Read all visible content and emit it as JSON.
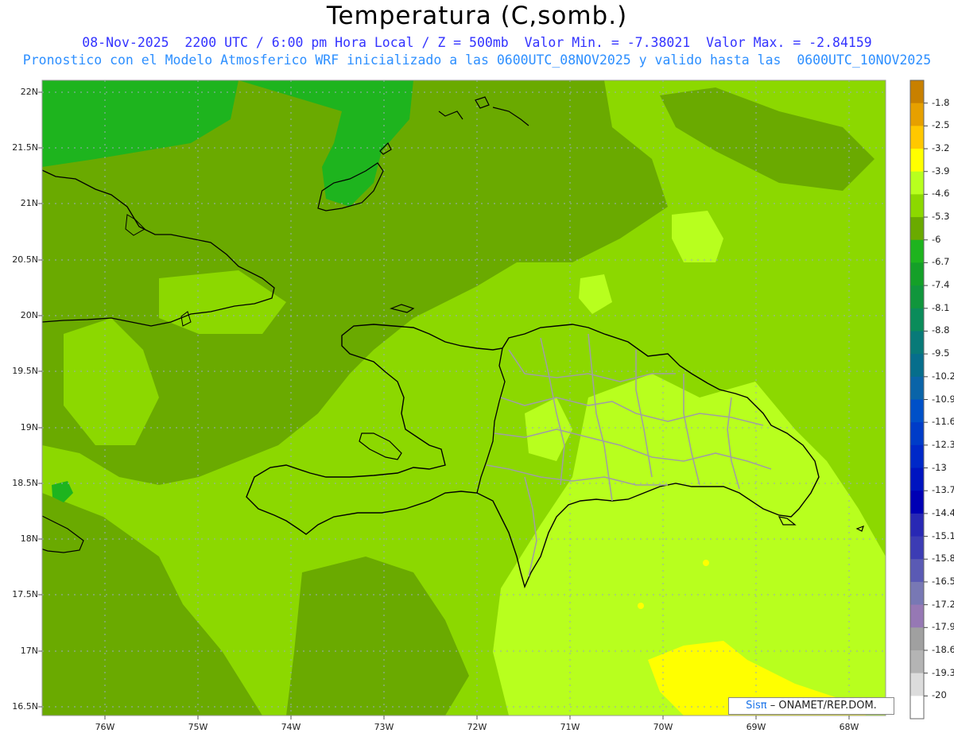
{
  "header": {
    "title": "Temperatura (C,somb.)",
    "subtitle_1": "08-Nov-2025  2200 UTC / 6:00 pm Hora Local / Z = 500mb  Valor Min. = -7.38021  Valor Max. = -2.84159",
    "subtitle_2": "Pronostico con el Modelo Atmosferico WRF inicializado a las 0600UTC_08NOV2025 y valido hasta las  0600UTC_10NOV2025"
  },
  "axes": {
    "lat_labels": [
      "22N",
      "21.5N",
      "21N",
      "20.5N",
      "20N",
      "19.5N",
      "19N",
      "18.5N",
      "18N",
      "17.5N",
      "17N",
      "16.5N"
    ],
    "lon_labels": [
      "76W",
      "75W",
      "74W",
      "73W",
      "72W",
      "71W",
      "70W",
      "69W",
      "68W"
    ]
  },
  "colorbar": {
    "labels": [
      "-1.8",
      "-2.5",
      "-3.2",
      "-3.9",
      "-4.6",
      "-5.3",
      "-6",
      "-6.7",
      "-7.4",
      "-8.1",
      "-8.8",
      "-9.5",
      "-10.2",
      "-10.9",
      "-11.6",
      "-12.3",
      "-13",
      "-13.7",
      "-14.4",
      "-15.1",
      "-15.8",
      "-16.5",
      "-17.2",
      "-17.9",
      "-18.6",
      "-19.3",
      "-20"
    ],
    "colors": [
      "#c88000",
      "#e6a000",
      "#ffc800",
      "#ffff00",
      "#b8ff1e",
      "#8cd800",
      "#6aaa00",
      "#1eb41e",
      "#14a028",
      "#10963c",
      "#0a8c5a",
      "#087a78",
      "#066e8c",
      "#0a64a8",
      "#0050c8",
      "#003cc8",
      "#0028c8",
      "#0014c0",
      "#0000b4",
      "#2828b4",
      "#3c3cb4",
      "#5a5ab4",
      "#7878b4",
      "#9678b4",
      "#a0a0a0",
      "#b4b4b4",
      "#dcdcdc",
      "#ffffff"
    ]
  },
  "credit": {
    "brand": "Sisπ",
    "text": "– ONAMET/REP.DOM."
  },
  "field_colors": {
    "dark_green": "#1eb41e",
    "mid_dark_green": "#6aaa00",
    "mid_green": "#8cd800",
    "light_green": "#b8ff1e",
    "yellow": "#ffff00",
    "coast": "#000000",
    "province": "#a0a0a0"
  }
}
